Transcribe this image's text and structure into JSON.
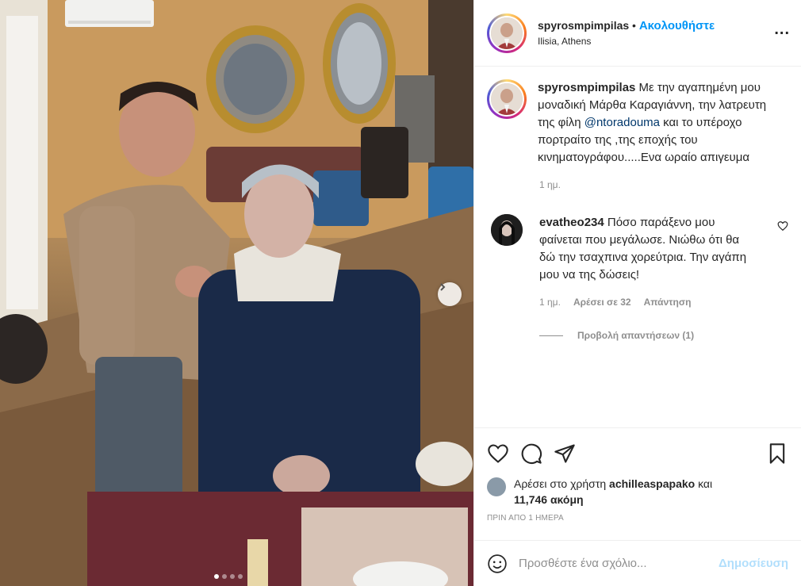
{
  "header": {
    "username": "spyrosmpimpilas",
    "separator": " • ",
    "follow_label": "Ακολουθήστε",
    "location": "Ilisia, Athens",
    "more_label": "..."
  },
  "caption": {
    "username": "spyrosmpimpilas",
    "text_before": " Με την αγαπημένη μου μοναδική Μάρθα Καραγιάννη, την λατρευτη της φίλη ",
    "mention": "@ntoradouma",
    "text_after": " και το υπέροχο πορτραίτο της ,της εποχής του κινηματογράφου.....Ενα ωραίο απιγευμα",
    "time": "1 ημ."
  },
  "comment": {
    "username": "evatheo234",
    "text": " Πόσο παράξενο μου φαίνεται που μεγάλωσε. Νιώθω ότι θα δώ την τσαχπινα χορεύτρια. Την αγάπη μου να της δώσεις!",
    "time": "1 ημ.",
    "likes": "Αρέσει σε 32",
    "reply": "Απάντηση",
    "view_replies": "Προβολή απαντήσεων (1)"
  },
  "likes": {
    "prefix": "Αρέσει στο χρήστη ",
    "user": "achilleaspapako",
    "middle": " και",
    "count": "11,746 ακόμη"
  },
  "posted": "ΠΡΙΝ ΑΠΟ 1 ΗΜΕΡΑ",
  "add_comment": {
    "placeholder": "Προσθέστε ένα σχόλιο...",
    "post_label": "Δημοσίευση"
  },
  "carousel": {
    "total": 4,
    "active": 1
  },
  "icons": [
    "more-options-icon",
    "heart-icon",
    "comment-icon",
    "share-icon",
    "save-icon",
    "emoji-icon",
    "chevron-right-icon"
  ],
  "colors": {
    "accent": "#0095f6",
    "post_disabled": "#b2dffc",
    "meta": "#8e8e8e"
  }
}
